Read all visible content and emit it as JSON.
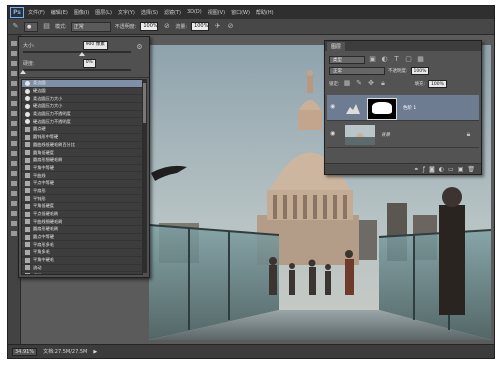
{
  "menubar": {
    "logo": "Ps",
    "items": [
      "文件(F)",
      "编辑(E)",
      "图像(I)",
      "图层(L)",
      "文字(Y)",
      "选择(S)",
      "滤镜(T)",
      "3D(D)",
      "视图(V)",
      "窗口(W)",
      "帮助(H)"
    ]
  },
  "options": {
    "mode_label": "模式:",
    "mode_value": "正常",
    "opacity_label": "不透明度:",
    "opacity_value": "100%",
    "flow_label": "流量:",
    "flow_value": "100%"
  },
  "brush_panel": {
    "size_label": "大小:",
    "size_value": "900 像素",
    "hardness_label": "硬度:",
    "hardness_value": "0%",
    "hardness_level": 0,
    "size_level": 0.55,
    "items": [
      "柔边圆",
      "硬边圆",
      "柔边圆压力大小",
      "硬边圆压力大小",
      "柔边圆压力不透明度",
      "硬边圆压力不透明度",
      "圆点硬",
      "圆钝形中等硬",
      "圆曲线低硬毛刷百分比",
      "圆角低硬度",
      "圆扇形细硬毛刷",
      "平角中等硬",
      "平曲线",
      "平点中等硬",
      "平扇形",
      "平钝形",
      "平角低硬度",
      "平点低硬毛刷",
      "平曲线细硬毛刷",
      "圆扇形硬毛刷",
      "圆点中等硬",
      "平扇形多毛",
      "平角多毛",
      "平角中硬毛",
      "流动",
      "喷溅",
      "水彩画",
      "水彩笔",
      "粉笔",
      "炭笔",
      "油彩",
      "蜡笔"
    ]
  },
  "layers_panel": {
    "tab": "图层",
    "filter_value": "类型",
    "blend_value": "正常",
    "opacity_label": "不透明度:",
    "opacity_value": "100%",
    "lock_label": "锁定:",
    "fill_label": "填充:",
    "fill_value": "100%",
    "layers": [
      {
        "name": "色阶 1",
        "selected": true
      },
      {
        "name": "背景",
        "selected": false
      }
    ]
  },
  "status": {
    "zoom": "34.91%",
    "doc": "文档:27.5M/27.5M"
  },
  "colors": {
    "accent": "#6e7c92",
    "panel": "#535353",
    "bg": "#3a3a3a"
  }
}
